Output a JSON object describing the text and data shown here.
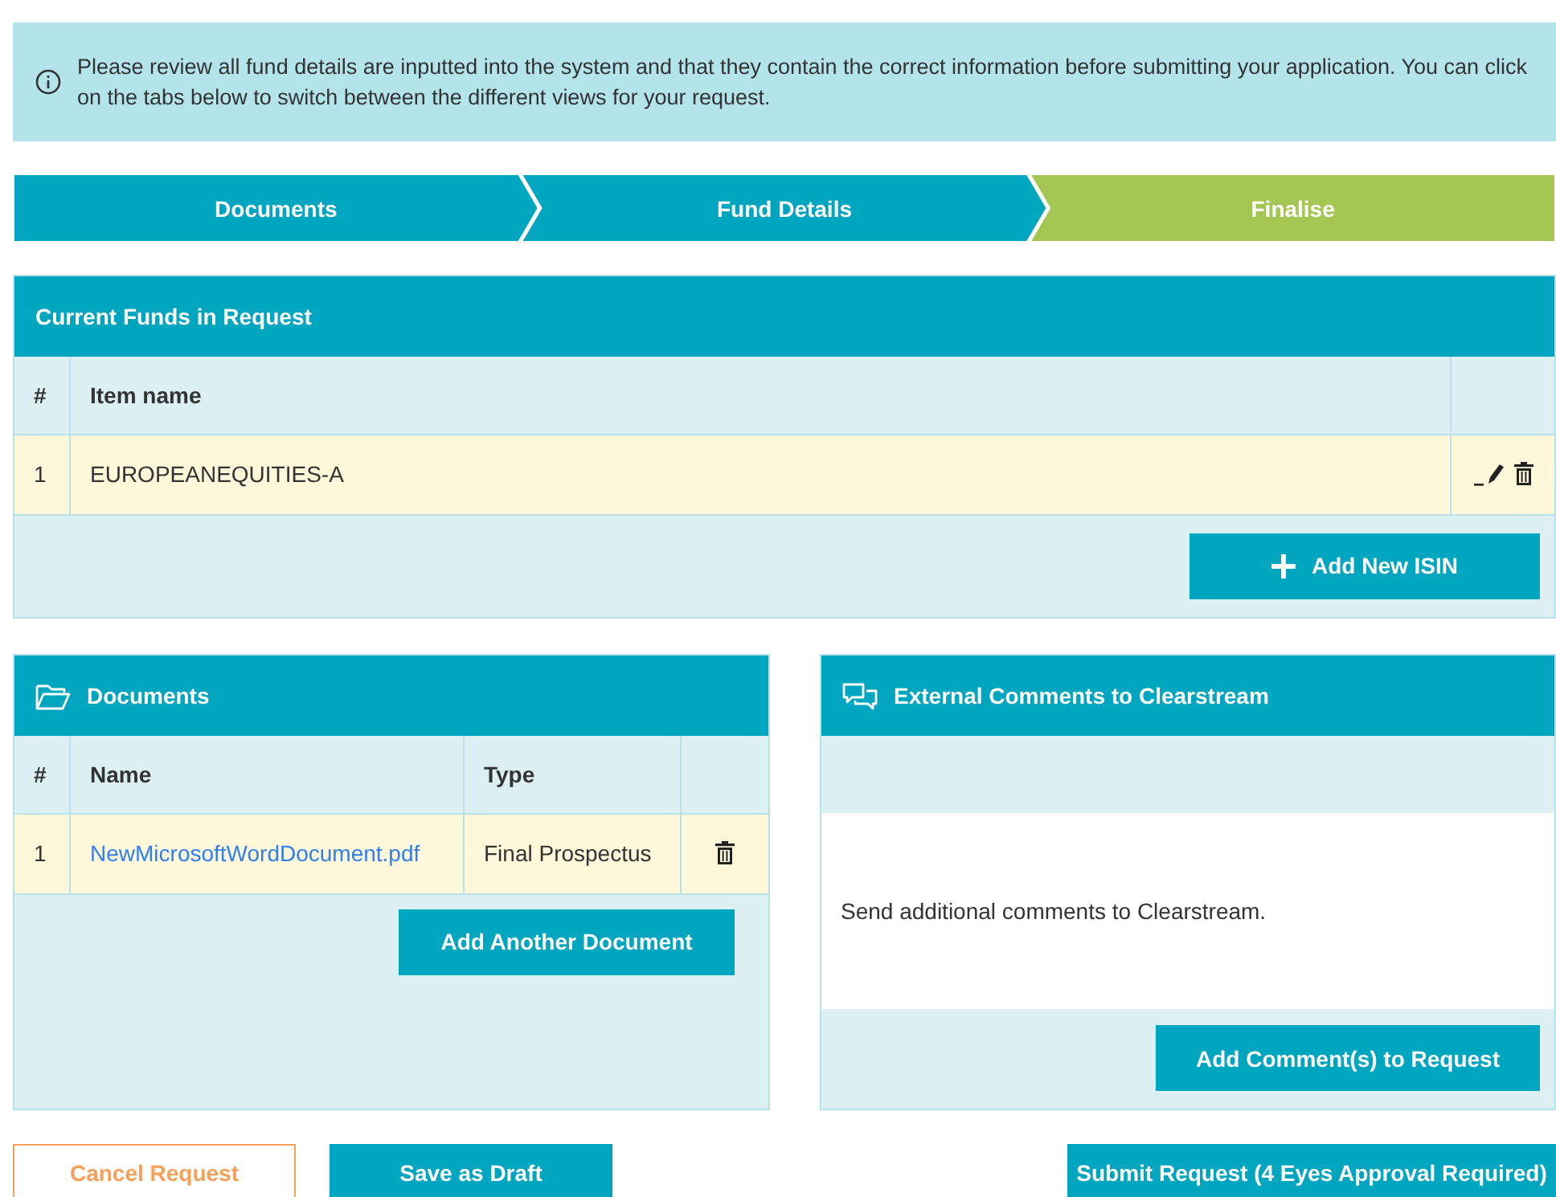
{
  "info": {
    "text": "Please review all fund details are inputted into the system and that they contain the correct information before submitting your application. You can click on the tabs below to switch between the different views for your request."
  },
  "steps": [
    {
      "label": "Documents",
      "selected": false
    },
    {
      "label": "Fund Details",
      "selected": false
    },
    {
      "label": "Finalise",
      "selected": true
    }
  ],
  "funds": {
    "title": "Current Funds in Request",
    "columns": [
      "#",
      "Item name"
    ],
    "rows": [
      {
        "index": "1",
        "name": "EUROPEANEQUITIES-A"
      }
    ],
    "add_button": "Add New ISIN"
  },
  "documents": {
    "title": "Documents",
    "columns": [
      "#",
      "Name",
      "Type"
    ],
    "rows": [
      {
        "index": "1",
        "name": "NewMicrosoftWordDocument.pdf",
        "type": "Final Prospectus"
      }
    ],
    "add_button": "Add Another Document"
  },
  "comments": {
    "title": "External Comments to Clearstream",
    "text": "Send additional comments to Clearstream.",
    "add_button": "Add Comment(s) to Request"
  },
  "actions": [
    {
      "label": "Cancel Request",
      "kind": "outline"
    },
    {
      "label": "Save as Draft",
      "kind": "primary"
    },
    {
      "label": "Submit Request (4 Eyes Approval Required)",
      "kind": "primary"
    }
  ]
}
